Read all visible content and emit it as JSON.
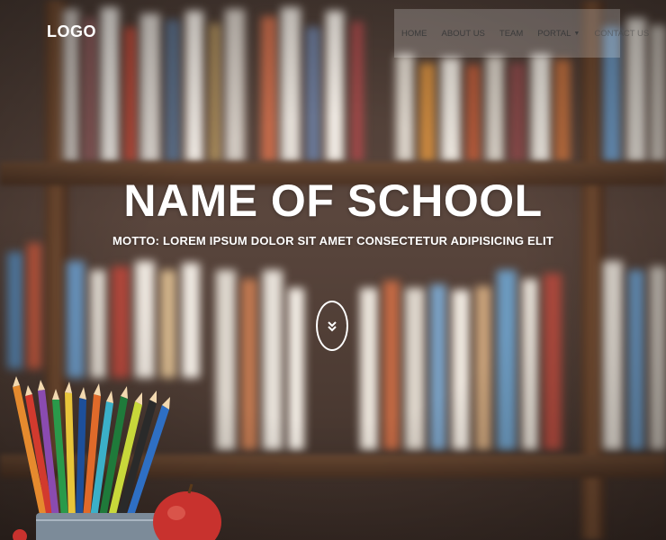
{
  "header": {
    "logo": "LOGO"
  },
  "nav": {
    "items": [
      {
        "label": "HOME"
      },
      {
        "label": "ABOUT US"
      },
      {
        "label": "TEAM"
      },
      {
        "label": "PORTAL",
        "has_dropdown": true
      },
      {
        "label": "CONTACT US"
      }
    ]
  },
  "hero": {
    "title": "NAME OF SCHOOL",
    "motto": "MOTTO: LOREM IPSUM DOLOR SIT AMET CONSECTETUR ADIPISICING ELIT",
    "scroll_icon": "double-chevron-down-icon"
  },
  "colors": {
    "text": "#ffffff",
    "nav_text": "#3b3b3b",
    "nav_background": "rgba(255,255,255,0.22)"
  }
}
